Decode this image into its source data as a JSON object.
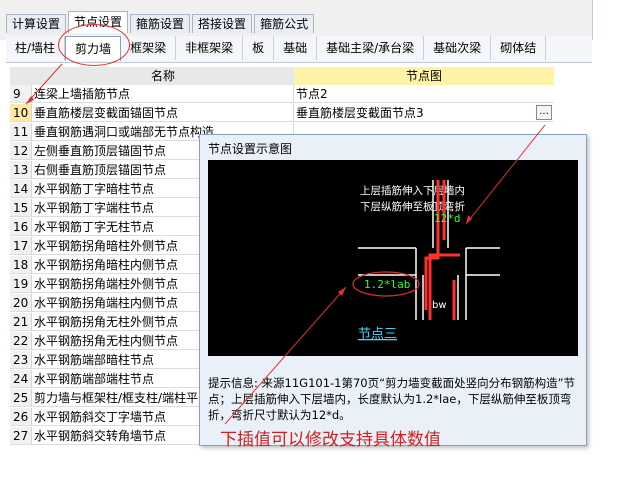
{
  "tabs_top": [
    "计算设置",
    "节点设置",
    "箍筋设置",
    "搭接设置",
    "箍筋公式"
  ],
  "tabs_top_active": 1,
  "tabs_sub": [
    "柱/墙柱",
    "剪力墙",
    "框架梁",
    "非框架梁",
    "板",
    "基础",
    "基础主梁/承台梁",
    "基础次梁",
    "砌体结"
  ],
  "tabs_sub_active": 1,
  "table": {
    "col_name": "名称",
    "col_node": "节点图",
    "rows": [
      {
        "num": "9",
        "name": "连梁上墙插筋节点",
        "node": "节点2"
      },
      {
        "num": "10",
        "name": "垂直筋楼层变截面锚固节点",
        "node": "垂直筋楼层变截面节点3",
        "selected": true
      },
      {
        "num": "11",
        "name": "垂直钢筋遇洞口或端部无节点构造",
        "node": ""
      },
      {
        "num": "12",
        "name": "左侧垂直筋顶层锚固节点",
        "node": ""
      },
      {
        "num": "13",
        "name": "右侧垂直筋顶层锚固节点",
        "node": ""
      },
      {
        "num": "14",
        "name": "水平钢筋丁字暗柱节点",
        "node": ""
      },
      {
        "num": "15",
        "name": "水平钢筋丁字端柱节点",
        "node": ""
      },
      {
        "num": "16",
        "name": "水平钢筋丁字无柱节点",
        "node": ""
      },
      {
        "num": "17",
        "name": "水平钢筋拐角暗柱外侧节点",
        "node": ""
      },
      {
        "num": "18",
        "name": "水平钢筋拐角暗柱内侧节点",
        "node": ""
      },
      {
        "num": "19",
        "name": "水平钢筋拐角端柱外侧节点",
        "node": ""
      },
      {
        "num": "20",
        "name": "水平钢筋拐角端柱内侧节点",
        "node": ""
      },
      {
        "num": "21",
        "name": "水平钢筋拐角无柱外侧节点",
        "node": ""
      },
      {
        "num": "22",
        "name": "水平钢筋拐角无柱内侧节点",
        "node": ""
      },
      {
        "num": "23",
        "name": "水平钢筋端部暗柱节点",
        "node": ""
      },
      {
        "num": "24",
        "name": "水平钢筋端部端柱节点",
        "node": ""
      },
      {
        "num": "25",
        "name": "剪力墙与框架柱/框支柱/端柱平",
        "node": ""
      },
      {
        "num": "26",
        "name": "水平钢筋斜交丁字墙节点",
        "node": ""
      },
      {
        "num": "27",
        "name": "水平钢筋斜交转角墙节点",
        "node": ""
      }
    ],
    "ellipsis_label": "..."
  },
  "dialog": {
    "title": "节点设置示意图",
    "drawing": {
      "note_line1": "上层插筋伸入下层墙内",
      "note_line2": "下层纵筋伸至板顶弯折",
      "dim_top": "12*d",
      "dim_lab": "1.2*lab",
      "dim_bw": "bw",
      "caption": "节点三"
    },
    "tip_label": "提示信息:",
    "tip_text": "来源11G101-1第70页“剪力墙变截面处竖向分布钢筋构造”节点；上层插筋伸入下层墙内，长度默认为1.2*lae，下层纵筋伸至板顶弯折，弯折尺寸默认为12*d。"
  },
  "annotation_text": "下插值可以修改支持具体数值",
  "colors": {
    "annotation": "#d02020",
    "canvas_bg": "#000000",
    "rebar": "#ff3030",
    "dim_green": "#30ff30",
    "caption_blue": "#4ad0ff"
  }
}
